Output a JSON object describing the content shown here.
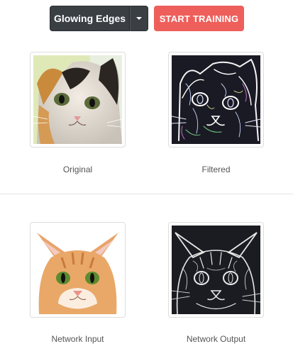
{
  "toolbar": {
    "filter_select": {
      "value": "Glowing Edges"
    },
    "train_button": {
      "label": "START TRAINING"
    }
  },
  "panels": [
    {
      "caption": "Original",
      "image": "calico-kitten-photo"
    },
    {
      "caption": "Filtered",
      "image": "glowing-edges-filtered-kitten"
    },
    {
      "caption": "Network Input",
      "image": "orange-tabby-kitten-photo"
    },
    {
      "caption": "Network Output",
      "image": "network-output-edges-kitten"
    }
  ],
  "colors": {
    "select_bg": "#3a3f44",
    "train_bg": "#ee5f5b",
    "edge_dark": "#1a1a24"
  },
  "icons": {
    "caret": "chevron-down-icon"
  }
}
